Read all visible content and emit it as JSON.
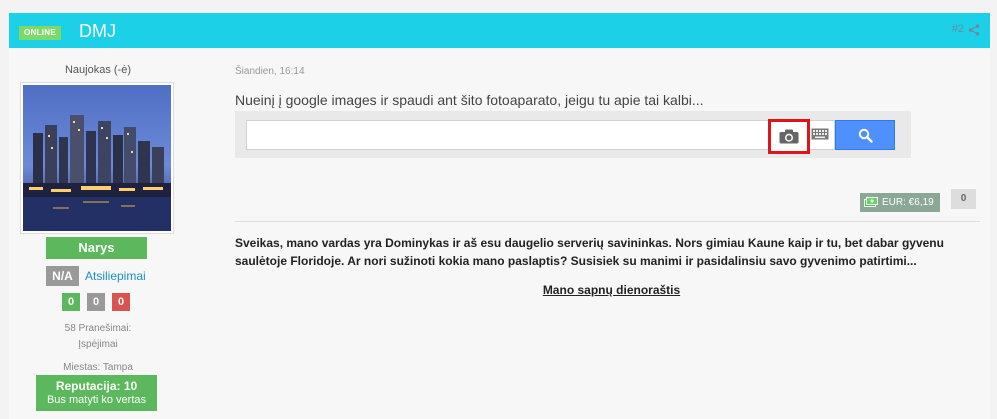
{
  "header": {
    "online_label": "ONLINE",
    "username": "DMJ",
    "post_number": "#2"
  },
  "sidebar": {
    "rank_title": "Naujokas (-ė)",
    "group": "Narys",
    "na_label": "N/A",
    "feedback_link": "Atsiliepimai",
    "votes": {
      "positive": "0",
      "neutral": "0",
      "negative": "0"
    },
    "posts": "58 Pranešimai:",
    "warnings": "Įspėjimai",
    "city": "Miestas: Tampa",
    "reputation_title": "Reputacija: 10",
    "reputation_sub": "Bus matyti ko vertas"
  },
  "post": {
    "date": "Šiandien, 16:14",
    "text": "Nueinį į google images ir spaudi ant šito fotoaparato, jeigu tu apie tai kalbi...",
    "search": {
      "value": "",
      "camera_icon": "camera-icon",
      "keyboard_icon": "keyboard-icon",
      "search_icon": "magnifier-icon"
    },
    "money": "EUR: €6,19",
    "money_zero": "0"
  },
  "signature": {
    "text": "Sveikas, mano vardas yra Dominykas ir aš esu daugelio serverių savininkas. Nors gimiau Kaune kaip ir tu, bet dabar gyvenu saulėtoje Floridoje. Ar nori sužinoti kokia mano paslaptis? Susisiek su manimi ir pasidalinsiu savo gyvenimo patirtimi...",
    "link": "Mano sapnų dienoraštis"
  },
  "colors": {
    "header": "#1cd0e8",
    "online": "#7dd96a",
    "group": "#5cb85c",
    "highlight": "#e0131b",
    "search_button": "#4d90fe"
  }
}
